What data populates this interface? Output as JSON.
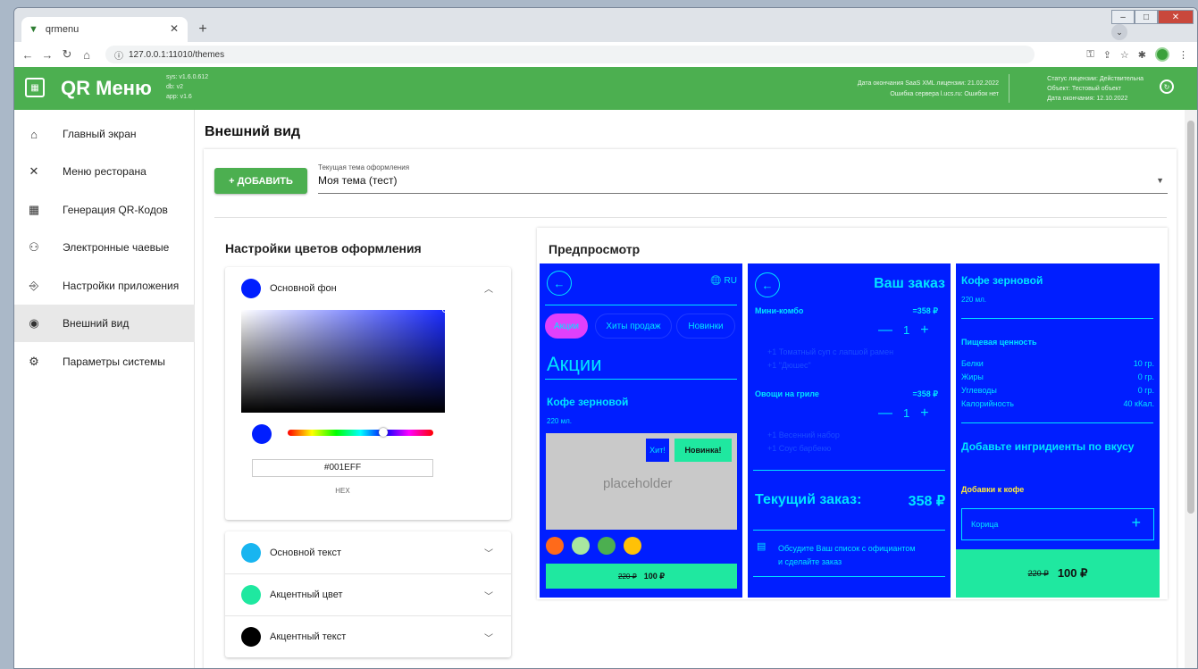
{
  "browser": {
    "tab_title": "qrmenu",
    "url": "127.0.0.1:11010/themes"
  },
  "appbar": {
    "title": "QR Меню",
    "versions": [
      "sys: v1.6.0.612",
      "db: v2",
      "app: v1.6"
    ],
    "license_lines": [
      "Дата окончания SaaS XML лицензии: 21.02.2022",
      "Ошибка сервера l.ucs.ru: Ошибок нет"
    ],
    "status_lines": [
      "Статус лицензии: Действительна",
      "Объект: Тестовый объект",
      "Дата окончания: 12.10.2022"
    ]
  },
  "sidebar": {
    "items": [
      {
        "label": "Главный экран",
        "icon": "home-icon"
      },
      {
        "label": "Меню ресторана",
        "icon": "cutlery-icon"
      },
      {
        "label": "Генерация QR-Кодов",
        "icon": "qr-icon"
      },
      {
        "label": "Электронные чаевые",
        "icon": "tips-icon"
      },
      {
        "label": "Настройки приложения",
        "icon": "app-settings-icon"
      },
      {
        "label": "Внешний вид",
        "icon": "eye-icon"
      },
      {
        "label": "Параметры системы",
        "icon": "gear-icon"
      }
    ]
  },
  "main": {
    "title": "Внешний вид",
    "add_label": "+ ДОБАВИТЬ",
    "theme_label": "Текущая тема оформления",
    "theme_value": "Моя тема (тест)"
  },
  "colors": {
    "heading": "Настройки цветов оформления",
    "items": [
      {
        "name": "Основной фон",
        "color": "#001eff"
      },
      {
        "name": "Основной текст",
        "color": "#18b5f0"
      },
      {
        "name": "Акцентный цвет",
        "color": "#1fe8a0"
      },
      {
        "name": "Акцентный текст",
        "color": "#000000"
      }
    ],
    "hex_value": "#001EFF",
    "hex_label": "HEX"
  },
  "preview": {
    "heading": "Предпросмотр",
    "screen1": {
      "lang": "RU",
      "tabs": [
        "Акции",
        "Хиты продаж",
        "Новинки"
      ],
      "section": "Акции",
      "item_name": "Кофе зерновой",
      "item_weight": "220 мл.",
      "badge_hit": "Хит!",
      "badge_new": "Новинка!",
      "placeholder": "placeholder",
      "old_price": "220 ₽",
      "price": "100 ₽"
    },
    "screen2": {
      "title": "Ваш заказ",
      "items": [
        {
          "name": "Мини-комбо",
          "price": "=358 ₽",
          "qty": "1",
          "mods": [
            "+1 Томатный суп с лапшой рамен",
            "+1 \"Дюшес\""
          ]
        },
        {
          "name": "Овощи на гриле",
          "price": "=358 ₽",
          "qty": "1",
          "mods": [
            "+1 Весенний набор",
            "+1 Соус барбекю"
          ]
        }
      ],
      "total_label": "Текущий заказ:",
      "total_value": "358 ₽",
      "hint": [
        "Обсудите Ваш список с официантом",
        "и сделайте заказ"
      ]
    },
    "screen3": {
      "title": "Кофе зерновой",
      "weight": "220 мл.",
      "nutrition_title": "Пищевая ценность",
      "nutrition": [
        {
          "k": "Белки",
          "v": "10 гр."
        },
        {
          "k": "Жиры",
          "v": "0 гр."
        },
        {
          "k": "Углеводы",
          "v": "0 гр."
        },
        {
          "k": "Калорийность",
          "v": "40 кКал."
        }
      ],
      "add_title": "Добавьте ингридиенты по вкусу",
      "group": "Добавки к кофе",
      "option": "Корица",
      "old_price": "220 ₽",
      "price": "100 ₽"
    }
  }
}
